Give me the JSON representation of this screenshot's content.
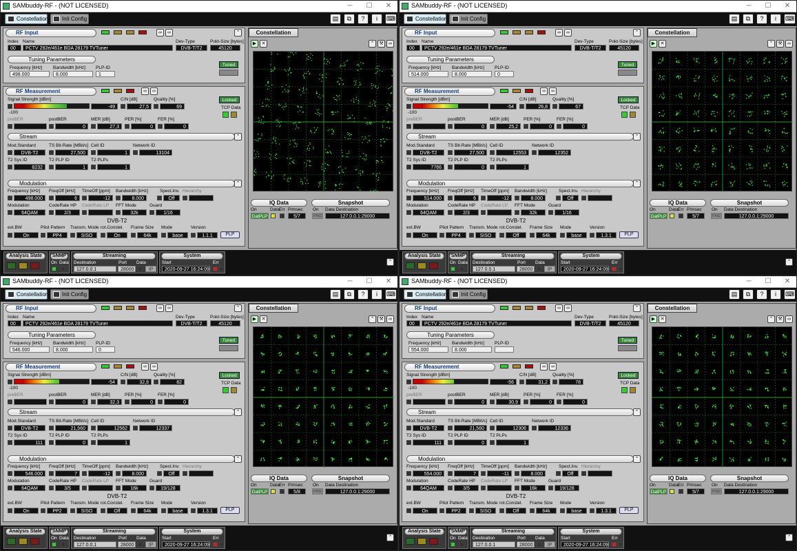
{
  "window": {
    "title": "SAMbuddy-RF - (NOT LICENSED)",
    "min_glyph": "─",
    "max_glyph": "☐",
    "close_glyph": "✕"
  },
  "toolbar": {
    "constellation_label": "Constellation",
    "init_config_label": "Init Config",
    "icons": [
      "document-icon",
      "copy-icon",
      "help-icon",
      "info-icon",
      "keyboard-icon"
    ]
  },
  "labels": {
    "rf_input": "RF Input",
    "index": "Index",
    "name": "Name",
    "dev_type": "Dev-Type",
    "pkt_size": "Pokt-Size [bytes]",
    "tuning_parameters": "Tuning Parameters",
    "frequency_khz": "Frequency [kHz]",
    "bandwidth_khz": "Bandwidth [kHz]",
    "plp_id": "PLP-ID",
    "tuned": "Tuned",
    "rf_measurement": "RF Measurement",
    "signal_strength": "Signal Strength [dBm]",
    "cn_db": "C/N [dB]",
    "quality": "Quality [%]",
    "locked": "Locked",
    "tcp_data": "TCP Data",
    "scale_min": "-100",
    "preber": "preBER",
    "postber": "postBER",
    "mer": "MER [dB]",
    "per": "PER [%]",
    "fer": "FER [%]",
    "stream": "Stream",
    "mod_standard": "Mod.Standard",
    "ts_bitrate": "TS Bit-Rate [MBit/s]",
    "cell_id": "Cell ID",
    "network_id": "Network ID",
    "t2_sys_id": "T2 Sys ID",
    "t2_plp_id": "T2 PLP ID",
    "t2_plps": "T2 PLPs",
    "modulation_title": "Modulation",
    "freq_khz": "Frequency [kHz]",
    "freq_off": "FreqOff [kHz]",
    "time_off": "TimeOff [ppm]",
    "bw_khz": "Bandwidth [kHz]",
    "spect_inv": "Spect.Inv.",
    "hierarchy": "Hierarchy",
    "modulation": "Modulation",
    "coderate_hp": "CodeRate HP",
    "coderate_lp": "CodeRate LP",
    "fft_mode": "FFT Mode",
    "guard": "Guard",
    "dvbt2": "DVB-T2",
    "ext_bw": "ext.BW",
    "pilot_pattern": "Pilot Pattern",
    "transm_mode": "Transm. Mode",
    "rot_constel": "rot.Constel.",
    "frame_size": "Frame Size",
    "mode": "Mode",
    "version": "Version",
    "plp_button": "PLP",
    "constellation_tab": "Constellation",
    "iq_data": "IQ Data",
    "on": "On",
    "data": "Data",
    "err": "Err",
    "p_msec": "P/msec",
    "dat_plp": "DatPLP",
    "snapshot": "Snapshot",
    "png": "PNG",
    "data_destination": "Data Destination",
    "analysis_state": "Analysis State",
    "snmp": "SNMP",
    "streaming": "Streaming",
    "destination": "Destination",
    "port": "Port",
    "system": "System",
    "start": "Start",
    "ip": "IP"
  },
  "instances": [
    {
      "index": "00",
      "name": "PCTV 292e/461e BDA 28179 TVTuner",
      "dev_type": "DVB-T/T2",
      "pkt_size": "45120",
      "tuning": {
        "frequency": "498.000",
        "bandwidth": "8.000",
        "plp_id": "1"
      },
      "measurement": {
        "signal": "-49",
        "signal_level": 0.7,
        "cn": "27,5",
        "quality": "69",
        "preber": "",
        "postber": "0",
        "mer": "27,3",
        "per": "0",
        "fer": "0"
      },
      "stream": {
        "mod_standard": "DVB-T2",
        "ts_bitrate": "27,500",
        "cell_id": "1",
        "network_id": "13104",
        "t2_sys_id": "8232",
        "t2_plp_id": "1",
        "t2_plps": "1"
      },
      "modulation": {
        "frequency": "498.000",
        "freq_off": "6",
        "time_off": "-12",
        "bandwidth": "8.000",
        "spect_inv": "Off",
        "hierarchy": "",
        "modulation": "64QAM",
        "coderate_hp": "2/3",
        "coderate_lp": "",
        "fft_mode": "32k",
        "guard": "1/16"
      },
      "dvbt2": {
        "ext_bw": "On",
        "pilot_pattern": "PP4",
        "transm_mode": "SISO",
        "rot_constel": "On",
        "frame_size": "64k",
        "mode": "base",
        "version": "1.1.1"
      },
      "iq": {
        "p_msec": "5/7",
        "snapshot_dest": "127.0.0.1:29000"
      },
      "streaming": {
        "destination": "127.0.0.1",
        "port": "28000"
      },
      "system": {
        "start": "2020-09-27 16:24:09"
      },
      "constellation": {
        "order": 8,
        "rotated": true,
        "spread": 0.45
      }
    },
    {
      "index": "00",
      "name": "PCTV 292e/461e BDA 28179 TVTuner",
      "dev_type": "DVB-T/T2",
      "pkt_size": "45120",
      "tuning": {
        "frequency": "514.000",
        "bandwidth": "8.000",
        "plp_id": "0"
      },
      "measurement": {
        "signal": "-54",
        "signal_level": 0.6,
        "cn": "26,8",
        "quality": "67",
        "preber": "",
        "postber": "0",
        "mer": "25,2",
        "per": "0",
        "fer": "0"
      },
      "stream": {
        "mod_standard": "DVB-T2",
        "ts_bitrate": "27,500",
        "cell_id": "12553",
        "network_id": "12352",
        "t2_sys_id": "7766",
        "t2_plp_id": "0",
        "t2_plps": "1"
      },
      "modulation": {
        "frequency": "514.000",
        "freq_off": "6",
        "time_off": "-12",
        "bandwidth": "8.000",
        "spect_inv": "Off",
        "hierarchy": "",
        "modulation": "64QAM",
        "coderate_hp": "2/3",
        "coderate_lp": "",
        "fft_mode": "32k",
        "guard": "1/16"
      },
      "dvbt2": {
        "ext_bw": "On",
        "pilot_pattern": "PP4",
        "transm_mode": "SISO",
        "rot_constel": "Off",
        "frame_size": "64k",
        "mode": "base",
        "version": "1.3.1"
      },
      "iq": {
        "p_msec": "5/7",
        "snapshot_dest": "127.0.0.1:29000"
      },
      "streaming": {
        "destination": "127.0.0.1",
        "port": "28000"
      },
      "system": {
        "start": "2020-09-27 16:24:09"
      },
      "constellation": {
        "order": 8,
        "rotated": false,
        "spread": 0.35
      }
    },
    {
      "index": "00",
      "name": "PCTV 292e/461e BDA 28179 TVTuner",
      "dev_type": "DVB-T/T2",
      "pkt_size": "45120",
      "tuning": {
        "frequency": "546.000",
        "bandwidth": "8.000",
        "plp_id": "0"
      },
      "measurement": {
        "signal": "-54",
        "signal_level": 0.6,
        "cn": "32,8",
        "quality": "82",
        "preber": "",
        "postber": "0",
        "mer": "32,3",
        "per": "0",
        "fer": "0"
      },
      "stream": {
        "mod_standard": "DVB-T2",
        "ts_bitrate": "21,560",
        "cell_id": "12562",
        "network_id": "12337",
        "t2_sys_id": "111",
        "t2_plp_id": "0",
        "t2_plps": "1"
      },
      "modulation": {
        "frequency": "546.000",
        "freq_off": "7",
        "time_off": "-12",
        "bandwidth": "8.000",
        "spect_inv": "Off",
        "hierarchy": "",
        "modulation": "64QAM",
        "coderate_hp": "3/5",
        "coderate_lp": "",
        "fft_mode": "16k",
        "guard": "19/128"
      },
      "dvbt2": {
        "ext_bw": "On",
        "pilot_pattern": "PP2",
        "transm_mode": "SISO",
        "rot_constel": "Off",
        "frame_size": "64k",
        "mode": "base",
        "version": "1.3.1"
      },
      "iq": {
        "p_msec": "5/8",
        "snapshot_dest": "127.0.0.1:29000"
      },
      "streaming": {
        "destination": "127.0.0.1",
        "port": "28000"
      },
      "system": {
        "start": "2020-09-27 16:24:09"
      },
      "constellation": {
        "order": 8,
        "rotated": false,
        "spread": 0.2
      }
    },
    {
      "index": "00",
      "name": "PCTV 292e/461e BDA 28179 TVTuner",
      "dev_type": "DVB-T/T2",
      "pkt_size": "45120",
      "tuning": {
        "frequency": "554.000",
        "bandwidth": "8.000",
        "plp_id": ""
      },
      "measurement": {
        "signal": "-56",
        "signal_level": 0.55,
        "cn": "31,2",
        "quality": "78",
        "preber": "",
        "postber": "0",
        "mer": "30,9",
        "per": "0",
        "fer": "0"
      },
      "stream": {
        "mod_standard": "DVB-T2",
        "ts_bitrate": "21,560",
        "cell_id": "12306",
        "network_id": "12336",
        "t2_sys_id": "111",
        "t2_plp_id": "0",
        "t2_plps": "1"
      },
      "modulation": {
        "frequency": "554.000",
        "freq_off": "7",
        "time_off": "-11",
        "bandwidth": "8.000",
        "spect_inv": "Off",
        "hierarchy": "",
        "modulation": "64QAM",
        "coderate_hp": "3/5",
        "coderate_lp": "",
        "fft_mode": "16k",
        "guard": "19/128"
      },
      "dvbt2": {
        "ext_bw": "On",
        "pilot_pattern": "PP2",
        "transm_mode": "SISO",
        "rot_constel": "Off",
        "frame_size": "64k",
        "mode": "base",
        "version": "1.3.1"
      },
      "iq": {
        "p_msec": "5/7",
        "snapshot_dest": "127.0.0.1:29000"
      },
      "streaming": {
        "destination": "127.0.0.1",
        "port": "28000"
      },
      "system": {
        "start": "2020-09-27 16:24:09"
      },
      "constellation": {
        "order": 8,
        "rotated": false,
        "spread": 0.22
      }
    }
  ],
  "colors": {
    "plot_point": "#3cff3c",
    "plot_grid": "#2a9a2a",
    "led_green": "#33cc33",
    "led_yellow": "#dddd44",
    "led_red": "#cc2222",
    "header_text": "#123c7c"
  }
}
